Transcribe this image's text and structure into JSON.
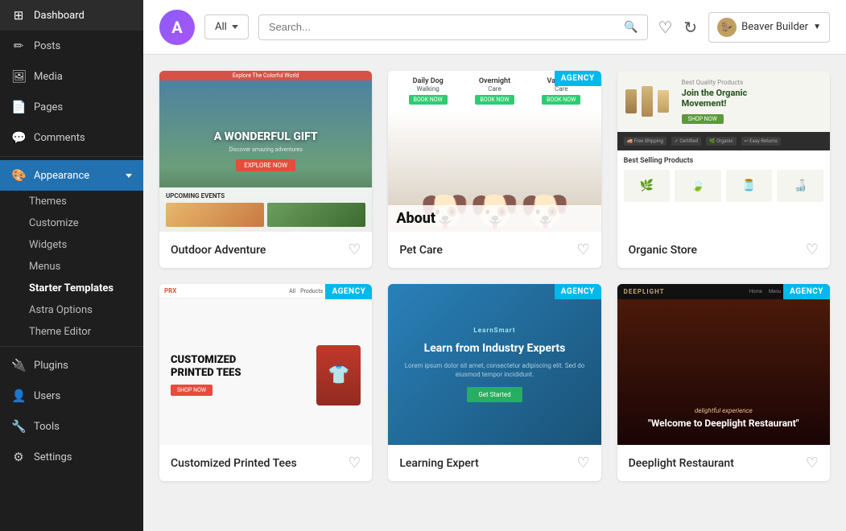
{
  "sidebar": {
    "items": [
      {
        "id": "dashboard",
        "label": "Dashboard",
        "icon": "⊞"
      },
      {
        "id": "posts",
        "label": "Posts",
        "icon": "📝"
      },
      {
        "id": "media",
        "label": "Media",
        "icon": "🖼"
      },
      {
        "id": "pages",
        "label": "Pages",
        "icon": "📄"
      },
      {
        "id": "comments",
        "label": "Comments",
        "icon": "💬"
      }
    ],
    "appearance": {
      "label": "Appearance",
      "icon": "🎨",
      "subitems": [
        {
          "id": "themes",
          "label": "Themes"
        },
        {
          "id": "customize",
          "label": "Customize"
        },
        {
          "id": "widgets",
          "label": "Widgets"
        },
        {
          "id": "menus",
          "label": "Menus"
        },
        {
          "id": "starter-templates",
          "label": "Starter Templates",
          "active": true
        },
        {
          "id": "astra-options",
          "label": "Astra Options"
        },
        {
          "id": "theme-editor",
          "label": "Theme Editor"
        }
      ]
    },
    "bottom_items": [
      {
        "id": "plugins",
        "label": "Plugins",
        "icon": "🔌"
      },
      {
        "id": "users",
        "label": "Users",
        "icon": "👤"
      },
      {
        "id": "tools",
        "label": "Tools",
        "icon": "🔧"
      },
      {
        "id": "settings",
        "label": "Settings",
        "icon": "⚙"
      }
    ]
  },
  "topbar": {
    "logo_letter": "A",
    "filter": {
      "label": "All",
      "placeholder": "Search..."
    },
    "search_placeholder": "Search...",
    "user_label": "Beaver Builder"
  },
  "templates": [
    {
      "id": "outdoor-adventure",
      "name": "Outdoor Adventure",
      "badge": null,
      "type": "outdoor"
    },
    {
      "id": "pet-care",
      "name": "Pet Care",
      "badge": "AGENCY",
      "type": "petcare"
    },
    {
      "id": "organic-store",
      "name": "Organic Store",
      "badge": null,
      "type": "organic"
    },
    {
      "id": "tshirt",
      "name": "Customized Printed Tees",
      "badge": "AGENCY",
      "type": "tshirt"
    },
    {
      "id": "learning",
      "name": "Learning Expert",
      "badge": "AGENCY",
      "type": "learning"
    },
    {
      "id": "restaurant",
      "name": "Deeplight Restaurant",
      "badge": "AGENCY",
      "type": "restaurant"
    }
  ]
}
